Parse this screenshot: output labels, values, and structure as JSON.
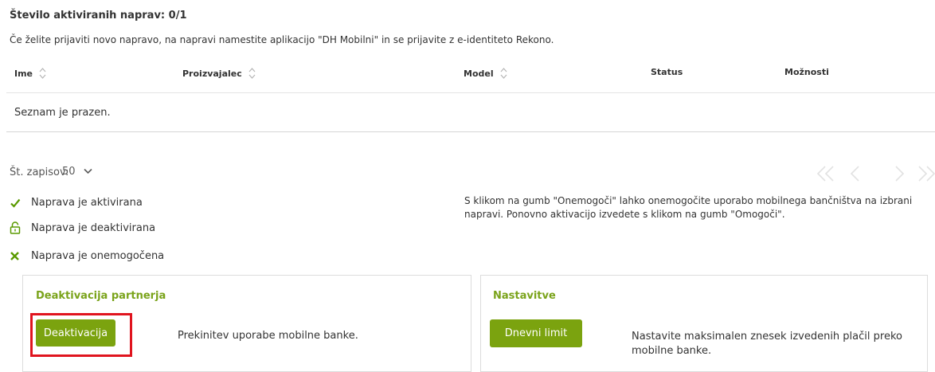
{
  "header": {
    "count_title": "Število aktiviranih naprav: 0/1",
    "info": "Če želite prijaviti novo napravo, na napravi namestite aplikacijo \"DH Mobilni\" in se prijavite z e-identiteto Rekono."
  },
  "table": {
    "columns": [
      "Ime",
      "Proizvajalec",
      "Model",
      "Status",
      "Možnosti"
    ],
    "empty_text": "Seznam je prazen."
  },
  "pagination": {
    "page_size_label": "Št. zapisov:",
    "page_size_value": "50"
  },
  "legend": [
    {
      "icon": "checkmark-icon",
      "label": "Naprava je aktivirana",
      "color": "#5a9a00"
    },
    {
      "icon": "padlock-icon",
      "label": "Naprava je deaktivirana",
      "color": "#5a9a00"
    },
    {
      "icon": "x-icon",
      "label": "Naprava je onemogočena",
      "color": "#5a9a00"
    }
  ],
  "side_info": "S klikom na gumb \"Onemogoči\" lahko onemogočite uporabo mobilnega bančništva na izbrani napravi. Ponovno aktivacijo izvedete s klikom na gumb \"Omogoči\".",
  "panels": {
    "deactivation": {
      "title": "Deaktivacija partnerja",
      "button": "Deaktivacija",
      "description": "Prekinitev uporabe mobilne banke."
    },
    "settings": {
      "title": "Nastavitve",
      "button": "Dnevni limit",
      "description": "Nastavite maksimalen znesek izvedenih plačil preko mobilne banke."
    }
  },
  "colors": {
    "accent": "#7ba30f",
    "highlight": "#e0141e"
  }
}
